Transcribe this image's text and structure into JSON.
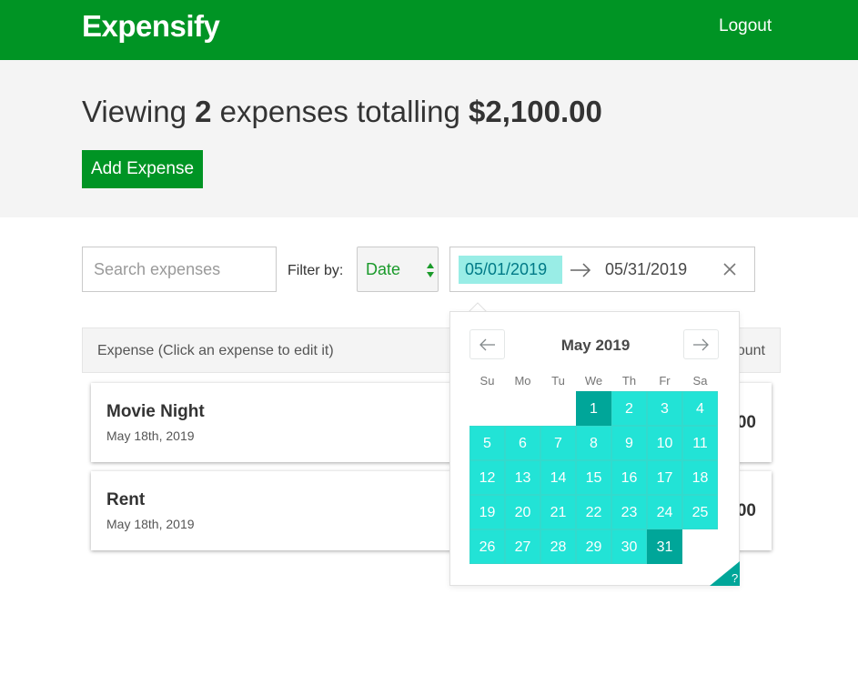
{
  "header": {
    "brand": "Expensify",
    "logout": "Logout"
  },
  "summary": {
    "prefix": "Viewing",
    "count": "2",
    "middle": "expenses totalling",
    "total": "$2,100.00",
    "add_button": "Add Expense"
  },
  "filters": {
    "search_placeholder": "Search expenses",
    "filter_label": "Filter by:",
    "sort_value": "Date",
    "start_date": "05/01/2019",
    "end_date": "05/31/2019"
  },
  "list": {
    "header_left": "Expense (Click an expense to edit it)",
    "header_right": "ount",
    "expenses": [
      {
        "description": "Movie Night",
        "date": "May 18th, 2019",
        "amount": "00"
      },
      {
        "description": "Rent",
        "date": "May 18th, 2019",
        "amount": "00"
      }
    ]
  },
  "calendar": {
    "month": "May 2019",
    "weekdays": [
      "Su",
      "Mo",
      "Tu",
      "We",
      "Th",
      "Fr",
      "Sa"
    ],
    "days": [
      "1",
      "2",
      "3",
      "4",
      "5",
      "6",
      "7",
      "8",
      "9",
      "10",
      "11",
      "12",
      "13",
      "14",
      "15",
      "16",
      "17",
      "18",
      "19",
      "20",
      "21",
      "22",
      "23",
      "24",
      "25",
      "26",
      "27",
      "28",
      "29",
      "30",
      "31"
    ],
    "help": "?"
  },
  "colors": {
    "brand_green": "#009424",
    "range_teal": "#22e3d6",
    "selected_teal": "#00a699",
    "start_highlight": "#99ede6"
  }
}
